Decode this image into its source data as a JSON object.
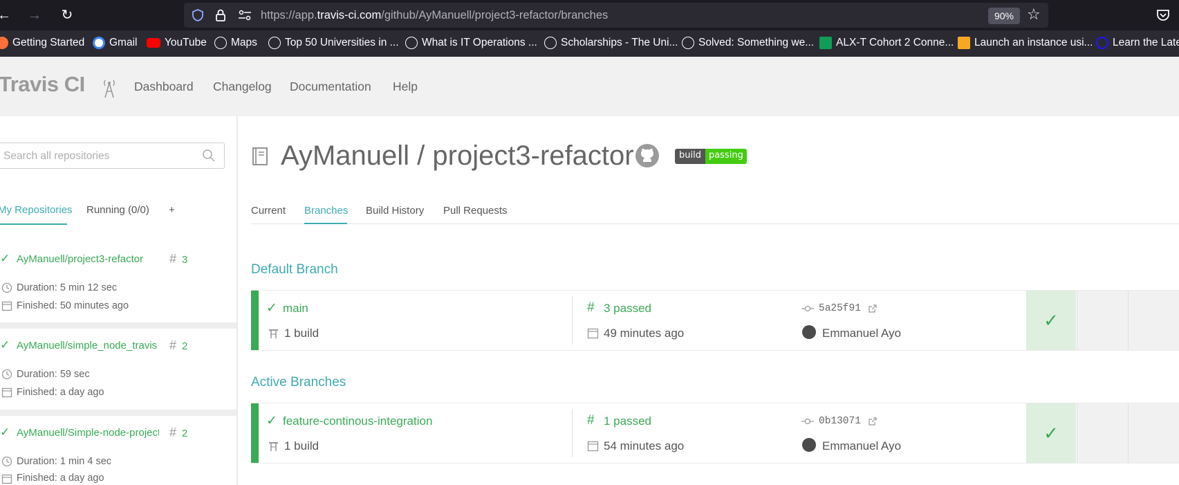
{
  "browser": {
    "url_prefix": "https://app.",
    "url_domain": "travis-ci.com",
    "url_path": "/github/AyManuell/project3-refactor/branches",
    "zoom": "90%",
    "bookmarks": [
      {
        "label": "Getting Started",
        "icon": "firefox-icon",
        "color": "#ff7139"
      },
      {
        "label": "Gmail",
        "icon": "google-icon",
        "color": "#4285f4"
      },
      {
        "label": "YouTube",
        "icon": "youtube-icon",
        "color": "#ff0000"
      },
      {
        "label": "Maps",
        "icon": "globe-icon",
        "color": "#fbfbfe"
      },
      {
        "label": "Top 50 Universities in ...",
        "icon": "globe-icon",
        "color": "#fbfbfe"
      },
      {
        "label": "What is IT Operations ...",
        "icon": "globe-icon",
        "color": "#fbfbfe"
      },
      {
        "label": "Scholarships - The Uni...",
        "icon": "globe-icon",
        "color": "#fbfbfe"
      },
      {
        "label": "Solved: Something we...",
        "icon": "globe-icon",
        "color": "#fbfbfe"
      },
      {
        "label": "ALX-T Cohort 2 Conne...",
        "icon": "sheets-icon",
        "color": "#0f9d58"
      },
      {
        "label": "Launch an instance usi...",
        "icon": "aws-icon",
        "color": "#f7a823"
      },
      {
        "label": "Learn the Late",
        "icon": "udacity-icon",
        "color": "#2015ff"
      }
    ]
  },
  "header": {
    "logo": "Travis CI",
    "nav": [
      "Dashboard",
      "Changelog",
      "Documentation",
      "Help"
    ]
  },
  "sidebar": {
    "search_placeholder": "Search all repositories",
    "tabs": [
      "My Repositories",
      "Running (0/0)",
      "+"
    ],
    "repos": [
      {
        "name": "AyManuell/project3-refactor",
        "number": "3",
        "duration": "Duration: 5 min 12 sec",
        "finished": "Finished: 50 minutes ago"
      },
      {
        "name": "AyManuell/simple_node_travis",
        "number": "2",
        "duration": "Duration: 59 sec",
        "finished": "Finished: a day ago"
      },
      {
        "name": "AyManuell/Simple-node-project",
        "number": "2",
        "duration": "Duration: 1 min 4 sec",
        "finished": "Finished: a day ago"
      }
    ]
  },
  "main": {
    "repo_title": "AyManuell / project3-refactor",
    "badge_left": "build",
    "badge_right": "passing",
    "tabs": [
      "Current",
      "Branches",
      "Build History",
      "Pull Requests"
    ],
    "default_branch_title": "Default Branch",
    "active_branches_title": "Active Branches",
    "branches": [
      {
        "name": "main",
        "builds": "1 build",
        "passed": "3 passed",
        "ago": "49 minutes ago",
        "commit": "5a25f91",
        "author": "Emmanuel Ayo"
      },
      {
        "name": "feature-continous-integration",
        "builds": "1 build",
        "passed": "1 passed",
        "ago": "54 minutes ago",
        "commit": "0b13071",
        "author": "Emmanuel Ayo"
      }
    ]
  },
  "colors": {
    "accent": "#3eaaaf",
    "passed": "#39aa56"
  }
}
